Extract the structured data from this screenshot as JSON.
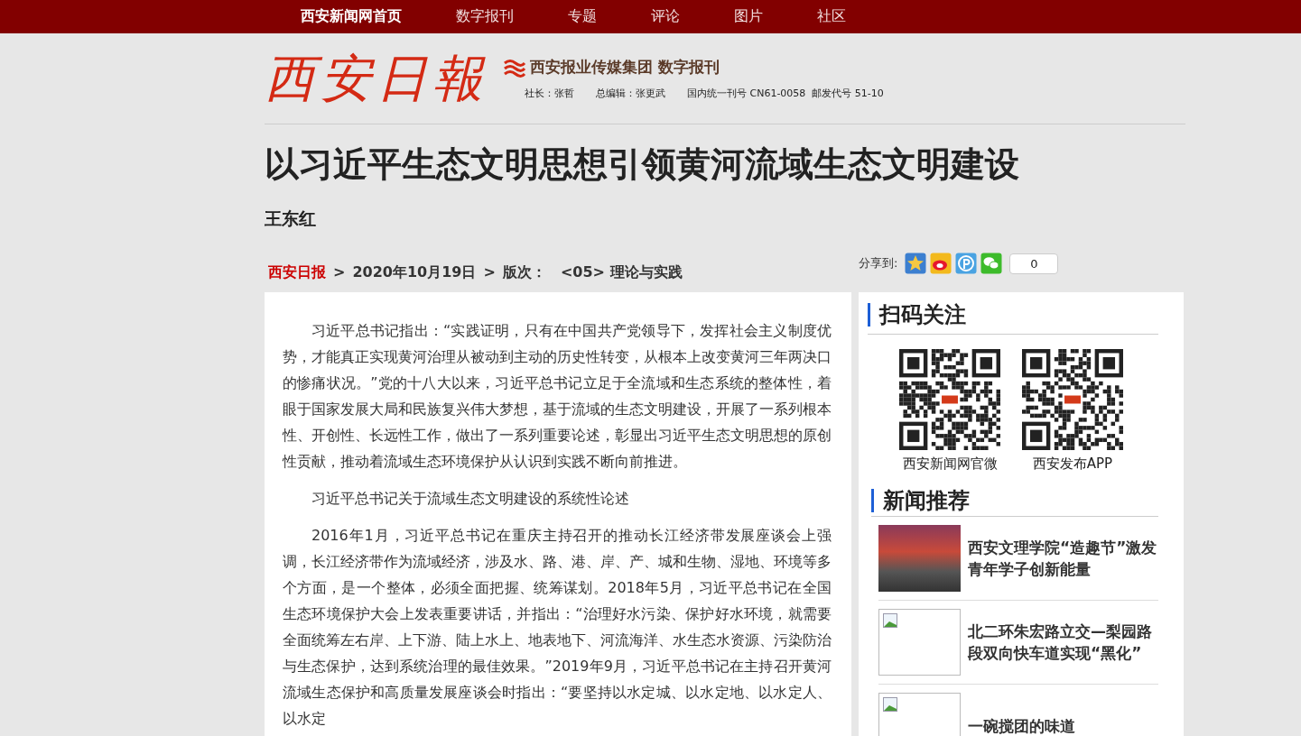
{
  "nav": [
    {
      "label": "西安新闻网首页",
      "selected": true
    },
    {
      "label": "数字报刊",
      "selected": false
    },
    {
      "label": "专题",
      "selected": false
    },
    {
      "label": "评论",
      "selected": false
    },
    {
      "label": "图片",
      "selected": false
    },
    {
      "label": "社区",
      "selected": false
    }
  ],
  "masthead": {
    "logo": "西安日報",
    "group": "西安报业传媒集团 数字报刊",
    "credits": [
      "社长：张哲",
      "总编辑：张更武",
      "国内统一刊号 CN61-0058  邮发代号 51-10"
    ]
  },
  "article": {
    "title": "以习近平生态文明思想引领黄河流域生态文明建设",
    "author": "王东红",
    "breadcrumb": {
      "paper": "西安日报",
      "sep1": ">",
      "date": "2020年10月19日",
      "sep2": ">",
      "edition_label": "版次：",
      "edition": "<05> 理论与实践"
    },
    "share": {
      "label": "分享到:",
      "count": "0"
    },
    "paragraphs": [
      "习近平总书记指出：“实践证明，只有在中国共产党领导下，发挥社会主义制度优势，才能真正实现黄河治理从被动到主动的历史性转变，从根本上改变黄河三年两决口的惨痛状况。”党的十八大以来，习近平总书记立足于全流域和生态系统的整体性，着眼于国家发展大局和民族复兴伟大梦想，基于流域的生态文明建设，开展了一系列根本性、开创性、长远性工作，做出了一系列重要论述，彰显出习近平生态文明思想的原创性贡献，推动着流域生态环境保护从认识到实践不断向前推进。",
      "习近平总书记关于流域生态文明建设的系统性论述",
      "2016年1月，习近平总书记在重庆主持召开的推动长江经济带发展座谈会上强调，长江经济带作为流域经济，涉及水、路、港、岸、产、城和生物、湿地、环境等多个方面，是一个整体，必须全面把握、统筹谋划。2018年5月，习近平总书记在全国生态环境保护大会上发表重要讲话，并指出：“治理好水污染、保护好水环境，就需要全面统筹左右岸、上下游、陆上水上、地表地下、河流海洋、水生态水资源、污染防治与生态保护，达到系统治理的最佳效果。”2019年9月，习近平总书记在主持召开黄河流域生态保护和高质量发展座谈会时指出：“要坚持以水定城、以水定地、以水定人、以水定"
    ]
  },
  "sidebar": {
    "qr_title": "扫码关注",
    "qr_codes": [
      {
        "caption": "西安新闻网官微"
      },
      {
        "caption": "西安发布APP"
      }
    ],
    "news_title": "新闻推荐",
    "news": [
      {
        "kind": "photo",
        "title": "西安文理学院“造趣节”激发青年学子创新能量"
      },
      {
        "kind": "broken",
        "title": "北二环朱宏路立交—梨园路段双向快车道实现“黑化”"
      },
      {
        "kind": "broken",
        "title": "一碗搅团的味道"
      }
    ]
  }
}
